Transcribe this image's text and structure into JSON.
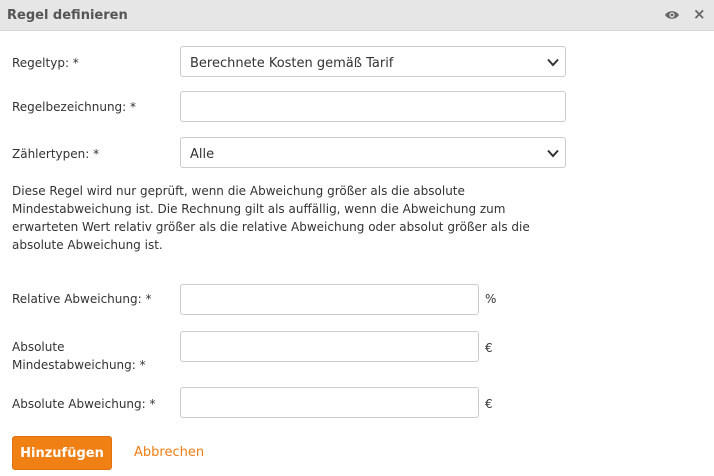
{
  "dialog": {
    "title": "Regel definieren",
    "eye_icon": "eye-icon",
    "close_glyph": "×"
  },
  "form": {
    "rule_type": {
      "label": "Regeltyp: *",
      "value": "Berechnete Kosten gemäß Tarif"
    },
    "rule_name": {
      "label": "Regelbezeichnung: *",
      "value": ""
    },
    "meter_types": {
      "label": "Zählertypen: *",
      "value": "Alle"
    },
    "info": "Diese Regel wird nur geprüft, wenn die Abweichung größer als die absolute Mindestabweichung ist. Die Rechnung gilt als auffällig, wenn die Abweichung zum erwarteten Wert relativ größer als die relative Abweichung oder absolut größer als die absolute Abweichung ist.",
    "relative_deviation": {
      "label": "Relative Abweichung: *",
      "value": "",
      "unit": "%"
    },
    "absolute_min_deviation": {
      "label_line1": "Absolute",
      "label_line2": "Mindestabweichung: *",
      "value": "",
      "unit": "€"
    },
    "absolute_deviation": {
      "label": "Absolute Abweichung: *",
      "value": "",
      "unit": "€"
    }
  },
  "actions": {
    "add_label": "Hinzufügen",
    "cancel_label": "Abbrechen"
  },
  "colors": {
    "accent": "#f07f14",
    "titlebar": "#e6e6e6"
  }
}
